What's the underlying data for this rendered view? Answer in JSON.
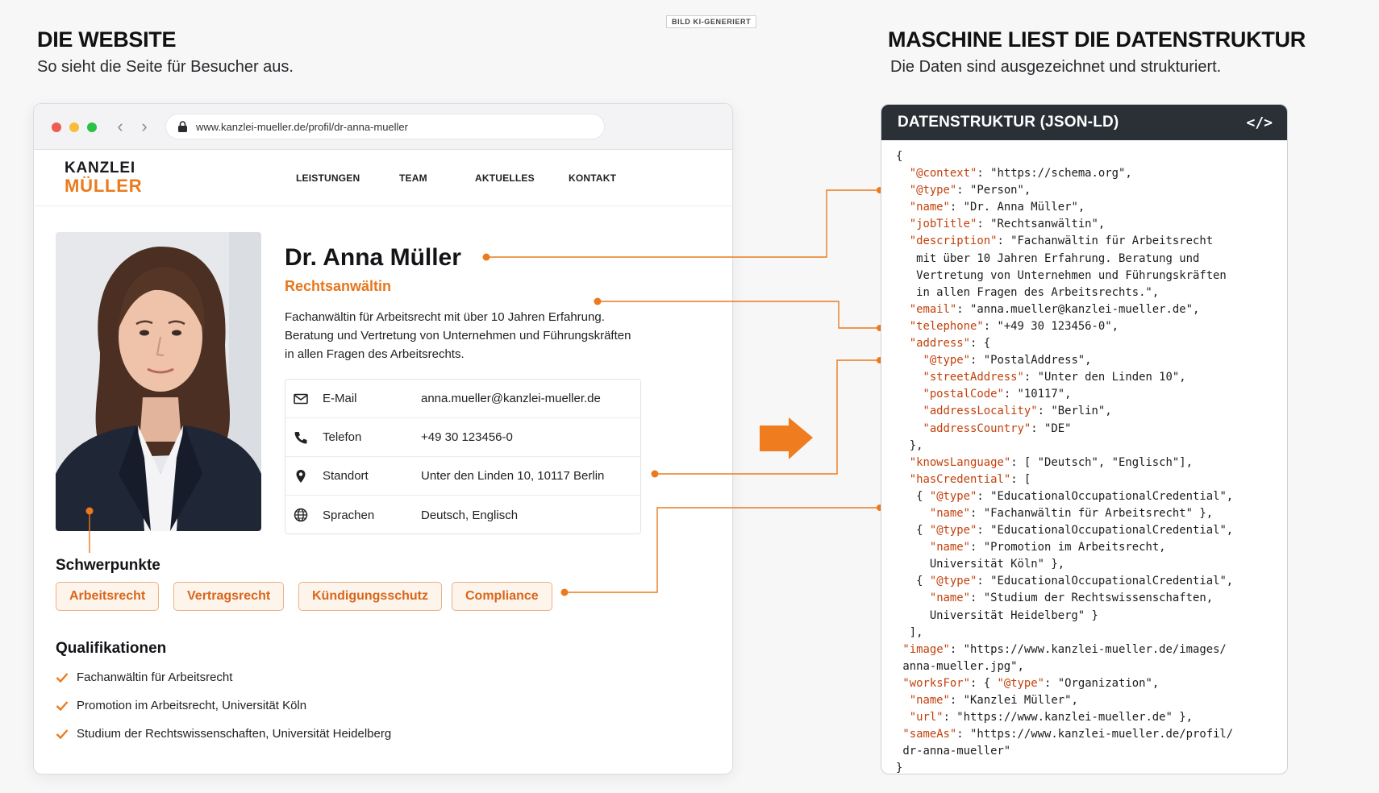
{
  "ai_badge": "BILD KI-GENERIERT",
  "left_section": {
    "title": "DIE WEBSITE",
    "subtitle": "So sieht die Seite für Besucher aus."
  },
  "right_section": {
    "title": "MASCHINE LIEST DIE DATENSTRUKTUR",
    "subtitle": "Die Daten sind ausgezeichnet und strukturiert."
  },
  "browser": {
    "url": "www.kanzlei-mueller.de/profil/dr-anna-mueller",
    "nav_back": "‹",
    "nav_forward": "›"
  },
  "site": {
    "logo_line1": "KANZLEI",
    "logo_line2": "MÜLLER",
    "nav": [
      "LEISTUNGEN",
      "TEAM",
      "AKTUELLES",
      "KONTAKT"
    ]
  },
  "profile": {
    "name": "Dr. Anna Müller",
    "role": "Rechtsanwältin",
    "description": "Fachanwältin für Arbeitsrecht mit über 10 Jahren Erfahrung. Beratung und Vertretung von Unternehmen und Führungskräften in allen Fragen des Arbeitsrechts.",
    "contacts": [
      {
        "icon": "mail-icon",
        "label": "E-Mail",
        "value": "anna.mueller@kanzlei-mueller.de"
      },
      {
        "icon": "phone-icon",
        "label": "Telefon",
        "value": "+49 30 123456-0"
      },
      {
        "icon": "location-icon",
        "label": "Standort",
        "value": "Unter den Linden 10, 10117 Berlin"
      },
      {
        "icon": "globe-icon",
        "label": "Sprachen",
        "value": "Deutsch, Englisch"
      }
    ],
    "focus_heading": "Schwerpunkte",
    "focus_tags": [
      "Arbeitsrecht",
      "Vertragsrecht",
      "Kündigungsschutz",
      "Compliance"
    ],
    "qual_heading": "Qualifikationen",
    "qualifications": [
      "Fachanwältin für Arbeitsrecht",
      "Promotion im Arbeitsrecht, Universität Köln",
      "Studium der Rechtswissenschaften, Universität Heidelberg"
    ]
  },
  "code_panel": {
    "title": "DATENSTRUKTUR (JSON-LD)",
    "icon_text": "</>"
  },
  "colors": {
    "accent": "#ec7a1c",
    "code_header": "#2b2f36",
    "key": "#c2410c"
  }
}
